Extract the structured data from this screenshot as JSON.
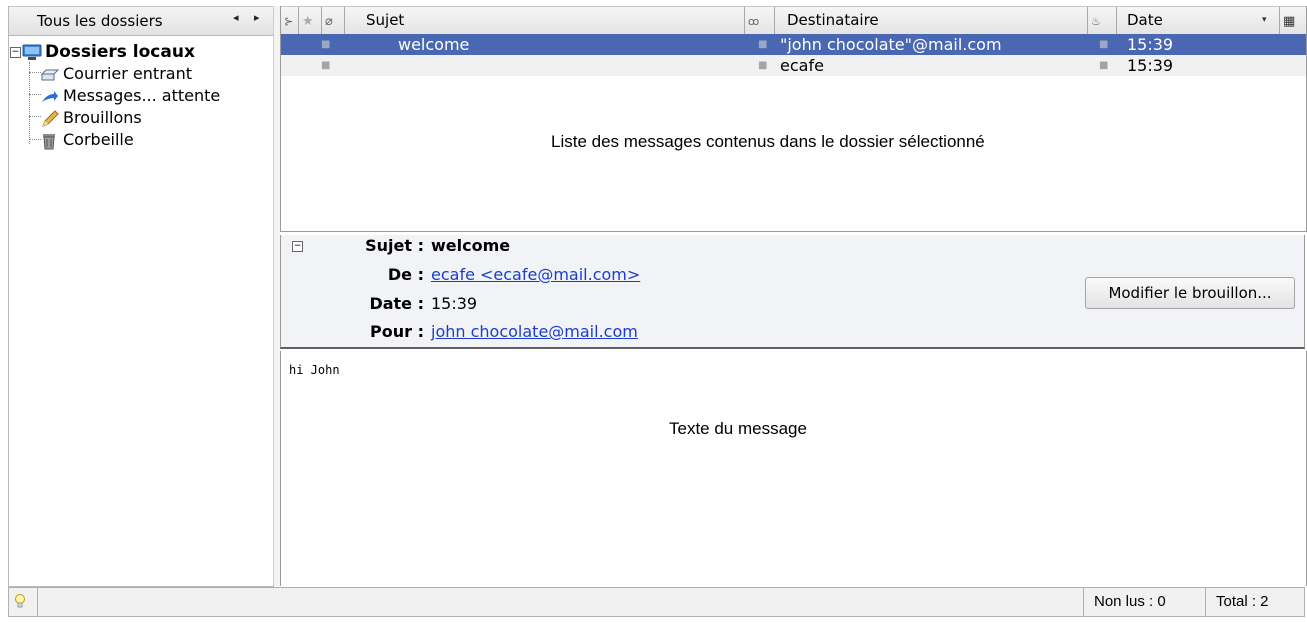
{
  "folder_pane": {
    "header_label": "Tous les dossiers",
    "nav_arrows": "◂ ▸",
    "root": {
      "label": "Dossiers locaux"
    },
    "items": [
      {
        "label": "Courrier entrant"
      },
      {
        "label": "Messages... attente"
      },
      {
        "label": "Brouillons"
      },
      {
        "label": "Corbeille"
      }
    ]
  },
  "message_list": {
    "columns": {
      "subject": "Sujet",
      "recipient": "Destinataire",
      "date": "Date"
    },
    "rows": [
      {
        "subject": "welcome",
        "recipient": "\"john chocolate\"@mail.com",
        "date": "15:39",
        "selected": true
      },
      {
        "subject": "",
        "recipient": "ecafe",
        "date": "15:39",
        "selected": false
      }
    ],
    "annotation": "Liste des messages contenus dans le dossier sélectionné"
  },
  "message_header": {
    "subject_label": "Sujet :",
    "subject_value": "welcome",
    "from_label": "De :",
    "from_value": "ecafe <ecafe@mail.com>",
    "date_label": "Date :",
    "date_value": "15:39",
    "to_label": "Pour :",
    "to_value": "john chocolate@mail.com",
    "edit_draft_label": "Modifier le brouillon..."
  },
  "message_body": {
    "text": "hi John",
    "annotation": "Texte du message"
  },
  "status_bar": {
    "unread": "Non lus : 0",
    "total": "Total : 2"
  },
  "colors": {
    "selection": "#4a68b1",
    "link": "#1a3dcf"
  }
}
